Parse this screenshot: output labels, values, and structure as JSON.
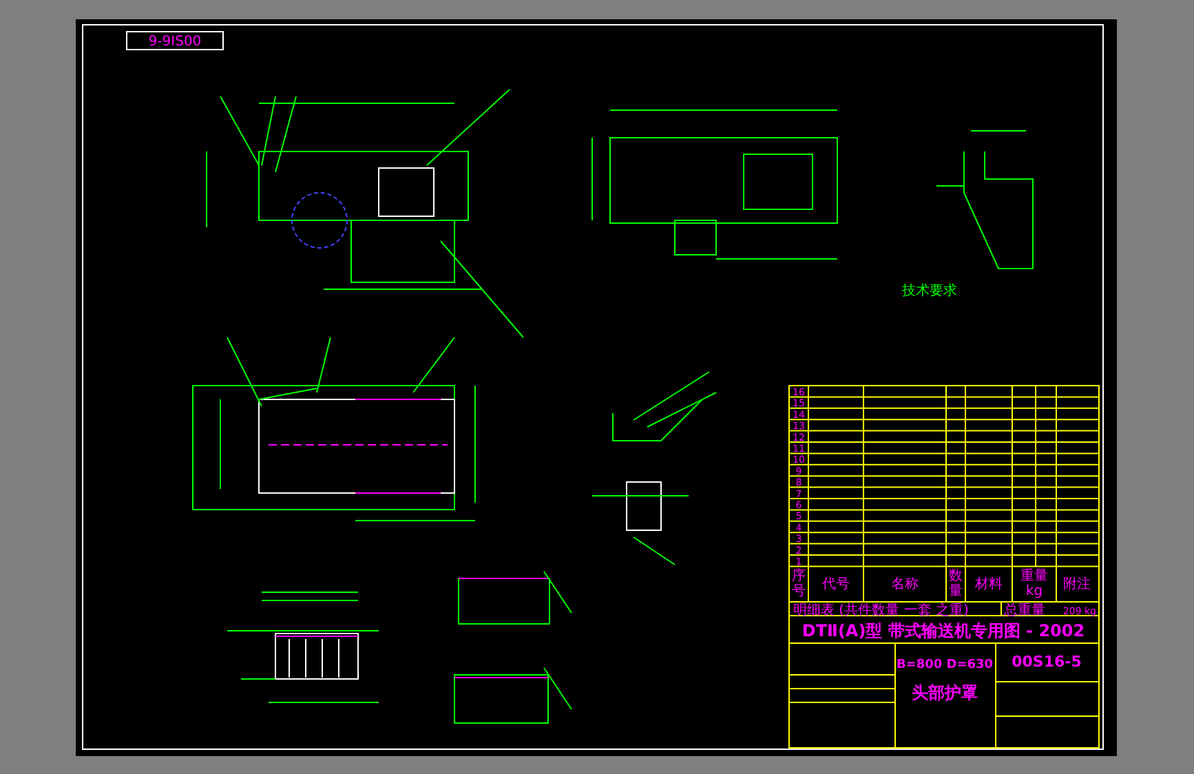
{
  "drawing_number": "9-9IS00",
  "notes": {
    "heading": "技术要求"
  },
  "parts_list": {
    "rows": [
      "16",
      "15",
      "14",
      "13",
      "12",
      "11",
      "10",
      "9",
      "8",
      "7",
      "6",
      "5",
      "4",
      "3",
      "2",
      "1"
    ],
    "header": [
      "序号",
      "代号",
      "名称",
      "数量",
      "材料",
      "重量 kg",
      "附注"
    ],
    "summary": "明细表 (共件数量 一套 之重)",
    "total_weight_label": "总重量",
    "total_weight": "209 kg"
  },
  "title_block": {
    "title": "DTⅡ(A)型 带式输送机专用图 - 2002",
    "spec": "B=800 D=630",
    "code": "00S16-5",
    "part_name": "头部护罩"
  }
}
